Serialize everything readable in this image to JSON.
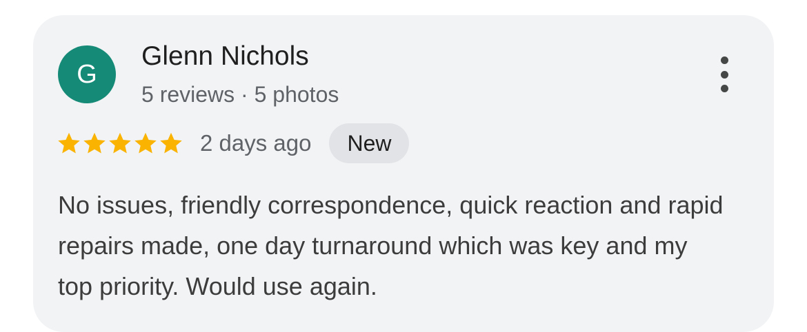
{
  "review": {
    "avatar_initial": "G",
    "avatar_color": "#158a77",
    "author_name": "Glenn Nichols",
    "author_meta": "5 reviews · 5 photos",
    "more_icon": "more-vert-icon",
    "rating": 5,
    "rating_max": 5,
    "star_color": "#f9b300",
    "date": "2 days ago",
    "badge": "New",
    "text": "No issues, friendly correspondence, quick reaction and rapid repairs made, one day turnaround which was key and my top priority. Would use again."
  }
}
